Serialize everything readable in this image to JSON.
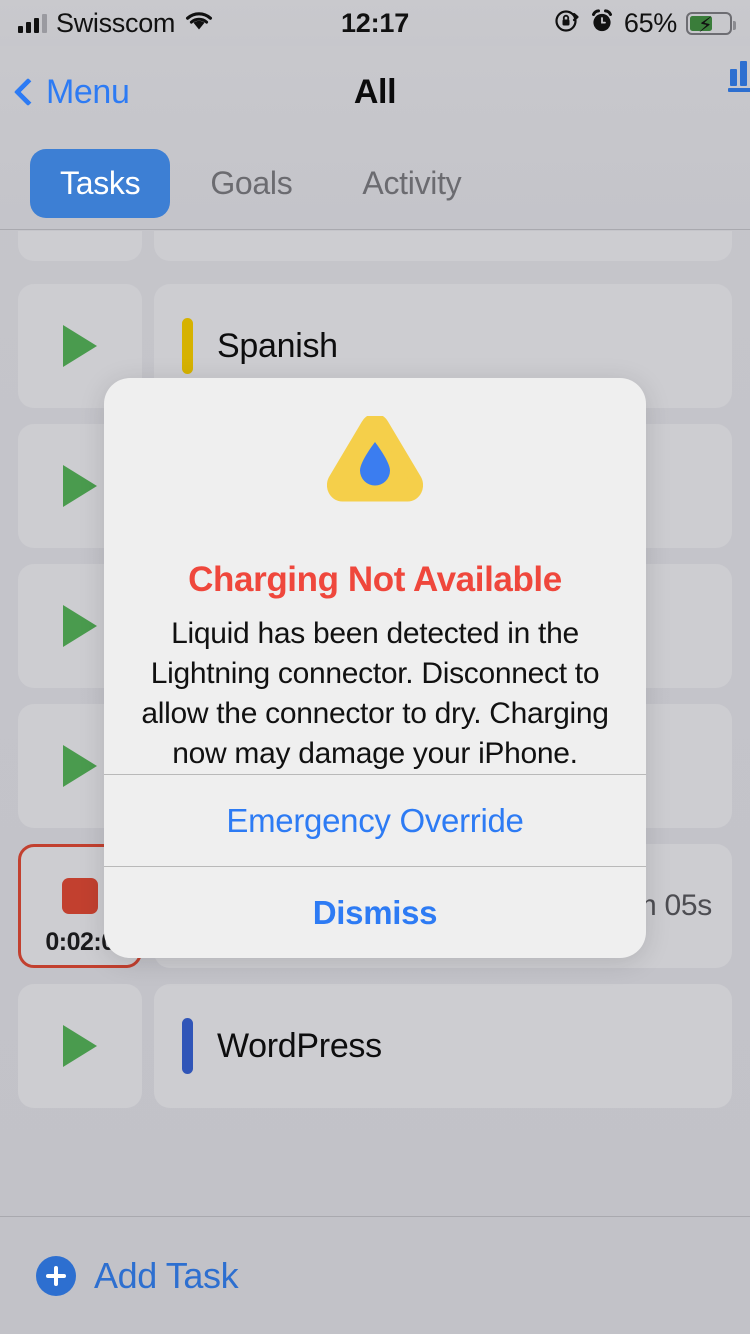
{
  "status_bar": {
    "carrier": "Swisscom",
    "time": "12:17",
    "battery_percent": "65%",
    "icons": [
      "signal-bars-icon",
      "wifi-icon",
      "rotation-lock-icon",
      "alarm-clock-icon",
      "battery-charging-icon"
    ]
  },
  "nav": {
    "back_label": "Menu",
    "title": "All",
    "right_icon": "bar-chart-icon"
  },
  "segments": [
    {
      "label": "Tasks",
      "active": true
    },
    {
      "label": "Goals",
      "active": false
    },
    {
      "label": "Activity",
      "active": false
    }
  ],
  "tasks": [
    {
      "name": "",
      "color": "",
      "duration": "",
      "running": false,
      "timer": ""
    },
    {
      "name": "Spanish",
      "color": "#d6b200",
      "duration": "",
      "running": false,
      "timer": ""
    },
    {
      "name": "",
      "color": "",
      "duration": "",
      "running": false,
      "timer": ""
    },
    {
      "name": "",
      "color": "",
      "duration": "",
      "running": false,
      "timer": ""
    },
    {
      "name": "",
      "color": "",
      "duration": "",
      "running": false,
      "timer": ""
    },
    {
      "name": "",
      "color": "",
      "duration": "m 05s",
      "running": true,
      "timer": "0:02:0"
    },
    {
      "name": "WordPress",
      "color": "#3055b8",
      "duration": "",
      "running": false,
      "timer": ""
    }
  ],
  "footer": {
    "add_task_label": "Add Task"
  },
  "alert": {
    "icon": "liquid-detected-warning-icon",
    "title": "Charging Not Available",
    "message": "Liquid has been detected in the Lightning connector. Disconnect to allow the connector to dry. Charging now may damage your iPhone.",
    "primary_button": "Emergency Override",
    "secondary_button": "Dismiss"
  },
  "colors": {
    "accent_blue": "#2d7bf4",
    "alert_red": "#ef473c",
    "warning_yellow": "#f5cf4a",
    "droplet_blue": "#3b7df0",
    "play_green": "#4a9b4e",
    "stop_red": "#c2402f"
  }
}
